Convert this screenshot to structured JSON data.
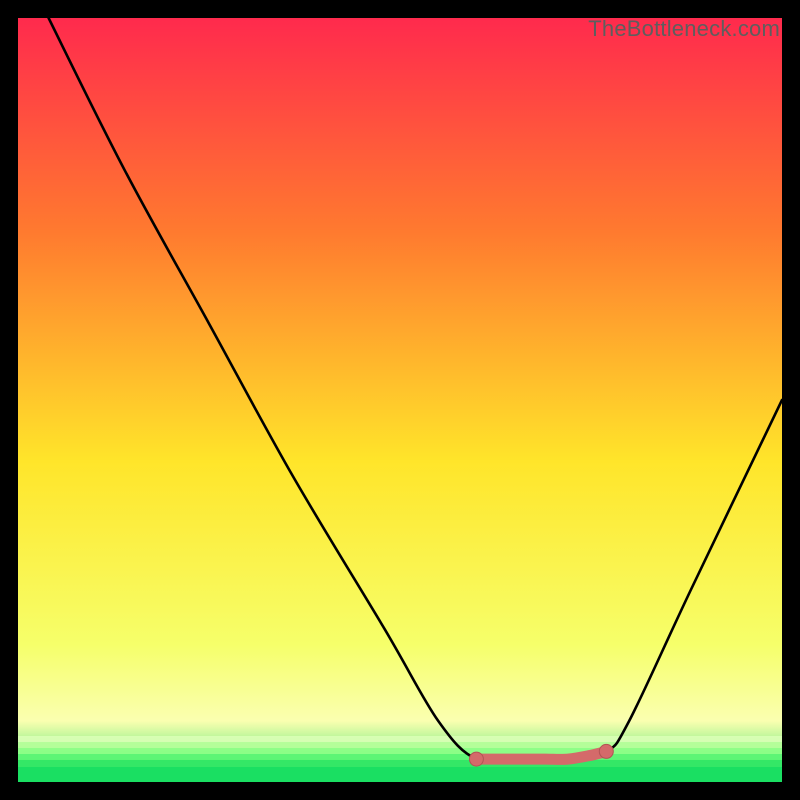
{
  "watermark": "TheBottleneck.com",
  "colors": {
    "frame_bg": "#000000",
    "gradient_top": "#ff2a4d",
    "gradient_mid1": "#ff7a2f",
    "gradient_mid2": "#ffe52a",
    "gradient_mid3": "#f6ff6a",
    "gradient_bottom_yellow": "#faffb0",
    "gradient_green": "#1adf62",
    "curve_stroke": "#000000",
    "marker_fill": "#d46a6a",
    "marker_stroke": "#b35454"
  },
  "chart_data": {
    "type": "line",
    "title": "",
    "xlabel": "",
    "ylabel": "",
    "xlim": [
      0,
      100
    ],
    "ylim": [
      0,
      100
    ],
    "series": [
      {
        "name": "bottleneck-curve",
        "points": [
          {
            "x": 4,
            "y": 100
          },
          {
            "x": 14,
            "y": 80
          },
          {
            "x": 25,
            "y": 60
          },
          {
            "x": 36,
            "y": 40
          },
          {
            "x": 48,
            "y": 20
          },
          {
            "x": 55,
            "y": 8
          },
          {
            "x": 60,
            "y": 3
          },
          {
            "x": 66,
            "y": 3
          },
          {
            "x": 72,
            "y": 3
          },
          {
            "x": 77,
            "y": 4
          },
          {
            "x": 80,
            "y": 8
          },
          {
            "x": 88,
            "y": 25
          },
          {
            "x": 100,
            "y": 50
          }
        ]
      }
    ],
    "markers": {
      "name": "highlight-range",
      "points": [
        {
          "x": 60,
          "y": 3
        },
        {
          "x": 63,
          "y": 3
        },
        {
          "x": 66,
          "y": 3
        },
        {
          "x": 69,
          "y": 3
        },
        {
          "x": 72,
          "y": 3
        },
        {
          "x": 75,
          "y": 3.5
        },
        {
          "x": 77,
          "y": 4
        }
      ],
      "endpoint_dots": [
        {
          "x": 60,
          "y": 3
        },
        {
          "x": 77,
          "y": 4
        }
      ]
    }
  }
}
